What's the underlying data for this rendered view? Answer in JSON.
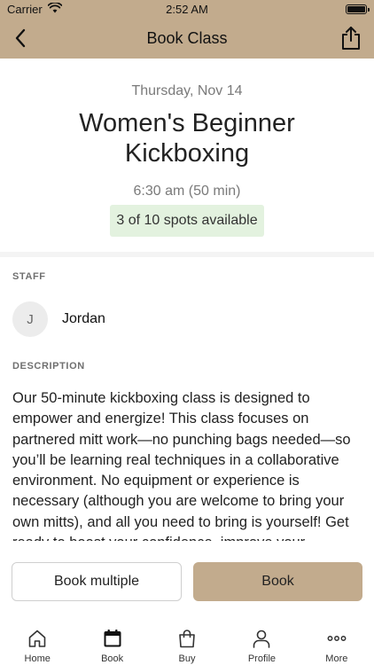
{
  "status_bar": {
    "carrier": "Carrier",
    "time": "2:52 AM"
  },
  "nav": {
    "title": "Book Class"
  },
  "class_info": {
    "date": "Thursday, Nov 14",
    "title": "Women's Beginner Kickboxing",
    "time": "6:30 am (50 min)",
    "spots": "3 of 10 spots available"
  },
  "staff": {
    "label": "STAFF",
    "initial": "J",
    "name": "Jordan"
  },
  "description": {
    "label": "DESCRIPTION",
    "text": "Our 50-minute kickboxing class is designed to empower and energize! This class focuses on partnered mitt work—no punching bags needed—so you’ll be learning real techniques in a collaborative environment. No equipment or experience is necessary (although you are welcome to bring your own mitts), and all you need to bring is yourself! Get ready to boost your confidence, improve your"
  },
  "actions": {
    "book_multiple": "Book multiple",
    "book": "Book"
  },
  "tabs": [
    {
      "label": "Home",
      "icon": "home-icon"
    },
    {
      "label": "Book",
      "icon": "calendar-icon",
      "active": true
    },
    {
      "label": "Buy",
      "icon": "shopping-bag-icon"
    },
    {
      "label": "Profile",
      "icon": "person-icon"
    },
    {
      "label": "More",
      "icon": "more-dots-icon"
    }
  ],
  "colors": {
    "brand": "#c2ab8d",
    "spots_badge_bg": "#e3f2df",
    "muted_text": "#7a7a7a"
  }
}
